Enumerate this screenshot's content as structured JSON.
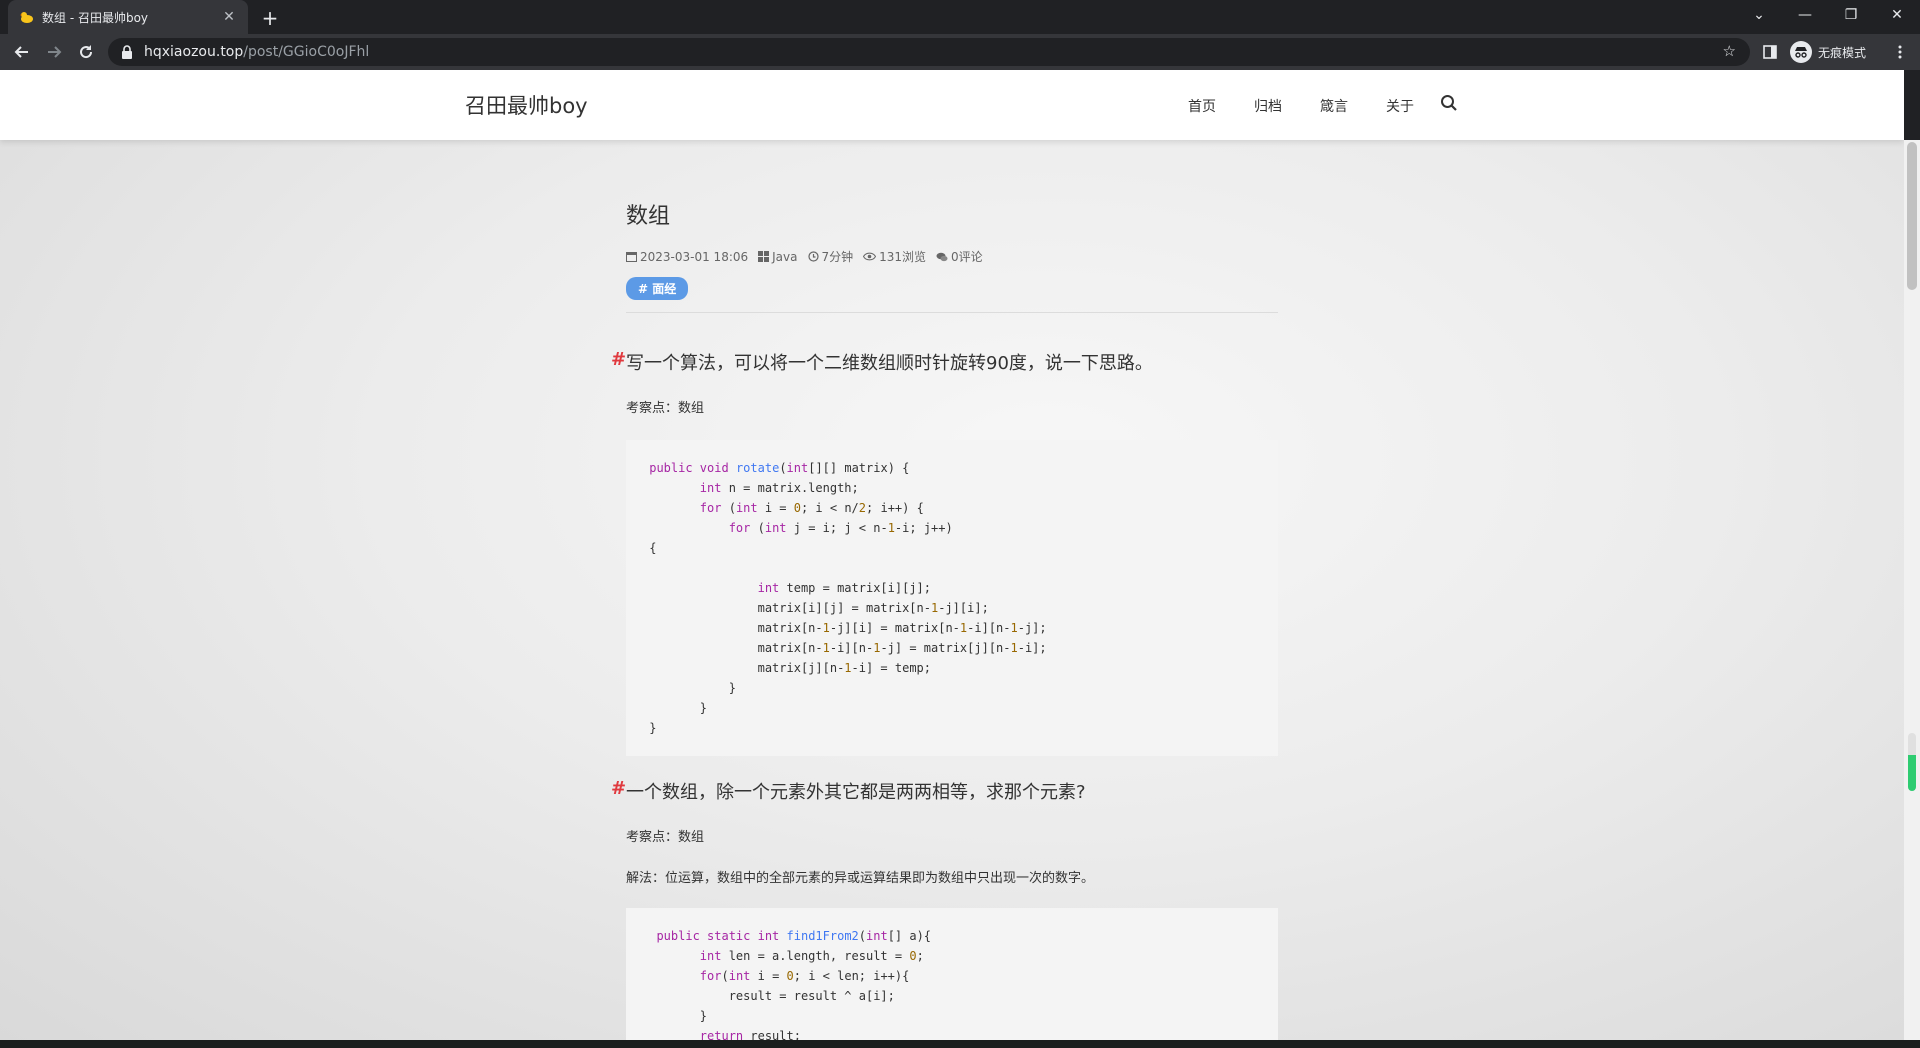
{
  "browser": {
    "tab_title": "数组 - 召田最帅boy",
    "tab_close": "✕",
    "new_tab": "+",
    "url_host": "hqxiaozou.top",
    "url_path": "/post/GGioC0oJFhl",
    "incognito_label": "无痕模式",
    "window_controls": {
      "dropdown": "⌄",
      "minimize": "—",
      "restore": "❐",
      "close": "✕"
    }
  },
  "site": {
    "logo": "召田最帅boy",
    "nav": [
      "首页",
      "归档",
      "箴言",
      "关于"
    ]
  },
  "post": {
    "title": "数组",
    "meta": {
      "date": "2023-03-01 18:06",
      "category": "Java",
      "read_time": "7分钟",
      "views": "131浏览",
      "comments": "0评论"
    },
    "tag": "# 面经",
    "sections": [
      {
        "heading": "写一个算法，可以将一个二维数组顺时针旋转90度，说一下思路。",
        "hash": "#",
        "paragraphs": [
          "考察点：数组"
        ],
        "code": [
          " public void rotate(int[][] matrix) {",
          "        int n = matrix.length;",
          "        for (int i = 0; i < n/2; i++) {",
          "            for (int j = i; j < n-1-i; j++)",
          " {",
          "",
          "                int temp = matrix[i][j];",
          "                matrix[i][j] = matrix[n-1-j][i];",
          "                matrix[n-1-j][i] = matrix[n-1-i][n-1-j];",
          "                matrix[n-1-i][n-1-j] = matrix[j][n-1-i];",
          "                matrix[j][n-1-i] = temp;",
          "            }",
          "        }",
          " }"
        ]
      },
      {
        "heading": "一个数组，除一个元素外其它都是两两相等，求那个元素?",
        "hash": "#",
        "paragraphs": [
          "考察点：数组",
          "解法：位运算，数组中的全部元素的异或运算结果即为数组中只出现一次的数字。"
        ],
        "code": [
          "  public static int find1From2(int[] a){",
          "        int len = a.length, result = 0;",
          "        for(int i = 0; i < len; i++){",
          "            result = result ^ a[i];",
          "        }",
          "        return result;",
          " }"
        ]
      }
    ]
  },
  "reading_progress": 0.62,
  "colors": {
    "accent_tag": "#5c9ae6",
    "heading_hash": "#e0393e",
    "progress": "#2ecc71"
  }
}
